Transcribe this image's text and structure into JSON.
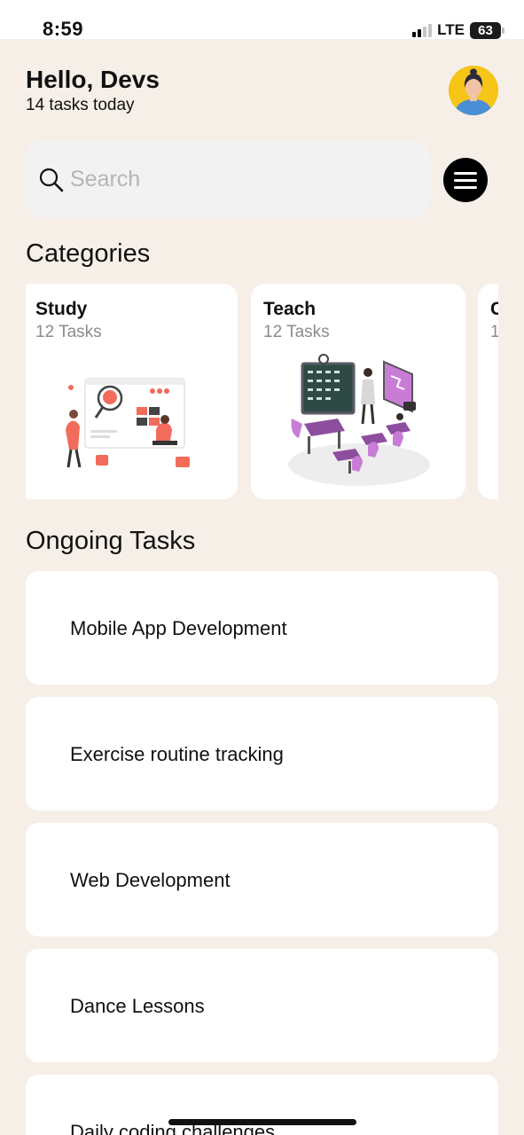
{
  "status_bar": {
    "time": "8:59",
    "network": "LTE",
    "battery": "63"
  },
  "header": {
    "greeting": "Hello, Devs",
    "subtitle": "14 tasks today"
  },
  "search": {
    "placeholder": "Search"
  },
  "icons": {
    "search": "search-icon",
    "menu": "menu-icon",
    "avatar": "user-avatar"
  },
  "categories": {
    "title": "Categories",
    "items": [
      {
        "title": "Study",
        "count": "12 Tasks"
      },
      {
        "title": "Teach",
        "count": "12 Tasks"
      },
      {
        "title": "C",
        "count": "1"
      }
    ]
  },
  "ongoing": {
    "title": "Ongoing Tasks",
    "tasks": [
      "Mobile App Development",
      "Exercise routine tracking",
      "Web Development",
      "Dance Lessons",
      "Daily coding challenges"
    ]
  },
  "colors": {
    "background": "#f6efe8",
    "card": "#ffffff",
    "accent_study": "#f26b5b",
    "accent_teach": "#8e4e9f"
  }
}
